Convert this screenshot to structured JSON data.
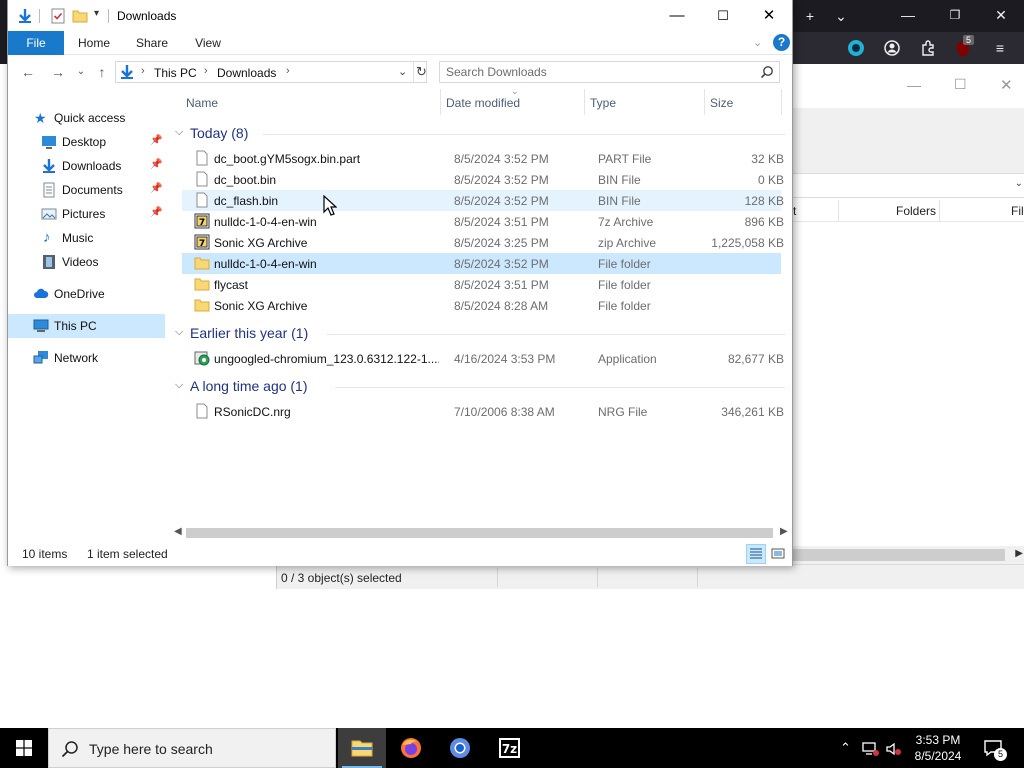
{
  "window": {
    "title": "Downloads",
    "ribbon_tabs": [
      "File",
      "Home",
      "Share",
      "View"
    ],
    "help_label": "?"
  },
  "address": {
    "crumbs": [
      "This PC",
      "Downloads"
    ],
    "search_placeholder": "Search Downloads"
  },
  "nav": {
    "quick_access": "Quick access",
    "desktop": "Desktop",
    "downloads": "Downloads",
    "documents": "Documents",
    "pictures": "Pictures",
    "music": "Music",
    "videos": "Videos",
    "onedrive": "OneDrive",
    "this_pc": "This PC",
    "network": "Network"
  },
  "columns": {
    "name": "Name",
    "date": "Date modified",
    "type": "Type",
    "size": "Size"
  },
  "groups": {
    "today": "Today (8)",
    "earlier": "Earlier this year (1)",
    "long_ago": "A long time ago (1)"
  },
  "files": [
    {
      "name": "dc_boot.gYM5sogx.bin.part",
      "date": "8/5/2024 3:52 PM",
      "type": "PART File",
      "size": "32 KB",
      "icon": "file-icon"
    },
    {
      "name": "dc_boot.bin",
      "date": "8/5/2024 3:52 PM",
      "type": "BIN File",
      "size": "0 KB",
      "icon": "file-icon"
    },
    {
      "name": "dc_flash.bin",
      "date": "8/5/2024 3:52 PM",
      "type": "BIN File",
      "size": "128 KB",
      "icon": "file-icon"
    },
    {
      "name": "nulldc-1-0-4-en-win",
      "date": "8/5/2024 3:51 PM",
      "type": "7z Archive",
      "size": "896 KB",
      "icon": "archive-icon"
    },
    {
      "name": "Sonic XG Archive",
      "date": "8/5/2024 3:25 PM",
      "type": "zip Archive",
      "size": "1,225,058 KB",
      "icon": "archive-icon"
    },
    {
      "name": "nulldc-1-0-4-en-win",
      "date": "8/5/2024 3:52 PM",
      "type": "File folder",
      "size": "",
      "icon": "folder-icon"
    },
    {
      "name": "flycast",
      "date": "8/5/2024 3:51 PM",
      "type": "File folder",
      "size": "",
      "icon": "folder-icon"
    },
    {
      "name": "Sonic XG Archive",
      "date": "8/5/2024 8:28 AM",
      "type": "File folder",
      "size": "",
      "icon": "folder-icon"
    },
    {
      "name": "ungoogled-chromium_123.0.6312.122-1....",
      "date": "4/16/2024 3:53 PM",
      "type": "Application",
      "size": "82,677 KB",
      "icon": "installer-icon"
    },
    {
      "name": "RSonicDC.nrg",
      "date": "7/10/2006 8:38 AM",
      "type": "NRG File",
      "size": "346,261 KB",
      "icon": "file-icon"
    }
  ],
  "status": {
    "items": "10 items",
    "selected": "1 item selected"
  },
  "sevenzip": {
    "col_partial": "t",
    "col_folders": "Folders",
    "col_files": "Fil",
    "status": "0 / 3 object(s) selected"
  },
  "browser": {
    "badge": "5"
  },
  "taskbar": {
    "search_placeholder": "Type here to search",
    "time": "3:53 PM",
    "date": "8/5/2024",
    "notification_count": "5"
  },
  "colors": {
    "accent": "#1979ca",
    "selection": "#cce8ff",
    "hover": "#e5f3ff",
    "group_title": "#1e3287"
  }
}
